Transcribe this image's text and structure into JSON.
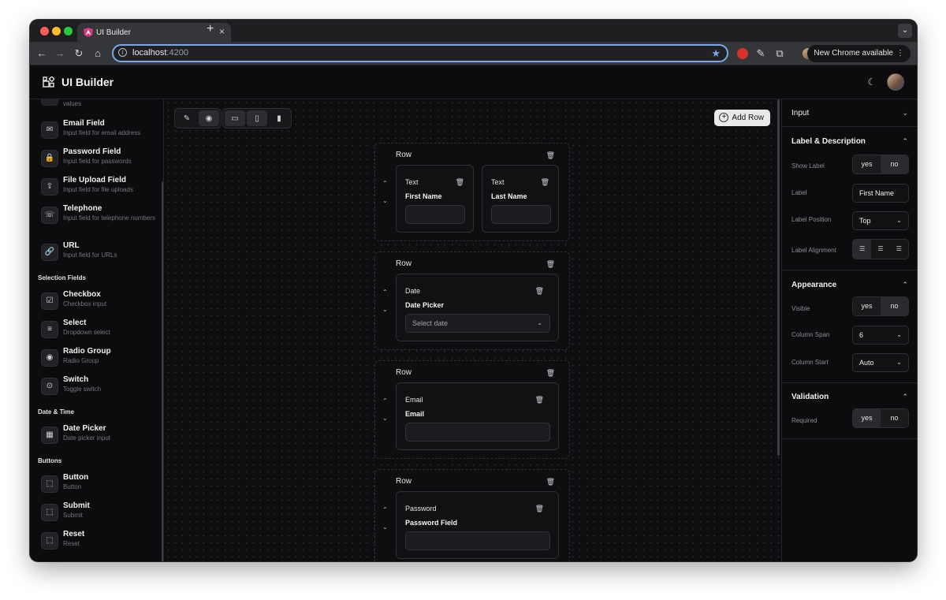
{
  "browser": {
    "tab_title": "UI Builder",
    "url_host": "localhost",
    "url_port": ":4200",
    "update_label": "New Chrome available"
  },
  "app": {
    "title": "UI Builder"
  },
  "sidebar": {
    "partial_desc": "values",
    "items_a": [
      {
        "name": "Email Field",
        "desc": "Input field for email address",
        "icon": "✉"
      },
      {
        "name": "Password Field",
        "desc": "Input field for passwords",
        "icon": "🔒"
      },
      {
        "name": "File Upload Field",
        "desc": "Input field for file uploads",
        "icon": "⇪"
      },
      {
        "name": "Telephone",
        "desc": "Input field for telephone numbers",
        "icon": "☏"
      },
      {
        "name": "URL",
        "desc": "Input field for URLs",
        "icon": "🔗"
      }
    ],
    "section_selection": "Selection Fields",
    "items_b": [
      {
        "name": "Checkbox",
        "desc": "Checkbox input",
        "icon": "☑"
      },
      {
        "name": "Select",
        "desc": "Dropdown select",
        "icon": "≡"
      },
      {
        "name": "Radio Group",
        "desc": "Radio Group",
        "icon": "◉"
      },
      {
        "name": "Switch",
        "desc": "Toggle switch",
        "icon": "⊙"
      }
    ],
    "section_date": "Date & Time",
    "items_c": [
      {
        "name": "Date Picker",
        "desc": "Date picker input",
        "icon": "▦"
      }
    ],
    "section_buttons": "Buttons",
    "items_d": [
      {
        "name": "Button",
        "desc": "Button",
        "icon": "⬚"
      },
      {
        "name": "Submit",
        "desc": "Submit",
        "icon": "⬚"
      },
      {
        "name": "Reset",
        "desc": "Reset",
        "icon": "⬚"
      }
    ]
  },
  "canvas": {
    "add_row_label": "Add Row",
    "rows": [
      {
        "title": "Row",
        "fields": [
          {
            "type": "Text",
            "label": "First Name",
            "value": ""
          },
          {
            "type": "Text",
            "label": "Last Name",
            "value": ""
          }
        ]
      },
      {
        "title": "Row",
        "fields": [
          {
            "type": "Date",
            "label": "Date Picker",
            "value": "Select date"
          }
        ]
      },
      {
        "title": "Row",
        "fields": [
          {
            "type": "Email",
            "label": "Email",
            "value": ""
          }
        ]
      },
      {
        "title": "Row",
        "fields": [
          {
            "type": "Password",
            "label": "Password Field",
            "value": ""
          }
        ]
      }
    ]
  },
  "properties": {
    "input_header": "Input",
    "label_section": {
      "title": "Label & Description",
      "show_label": "Show Label",
      "label": "Label",
      "label_value": "First Name",
      "label_position": "Label Position",
      "label_position_value": "Top",
      "label_alignment": "Label Alignment"
    },
    "appearance_section": {
      "title": "Appearance",
      "visible": "Visible",
      "column_span": "Column Span",
      "column_span_value": "6",
      "column_start": "Column Start",
      "column_start_value": "Auto"
    },
    "validation_section": {
      "title": "Validation",
      "required": "Required"
    },
    "yes": "yes",
    "no": "no"
  }
}
